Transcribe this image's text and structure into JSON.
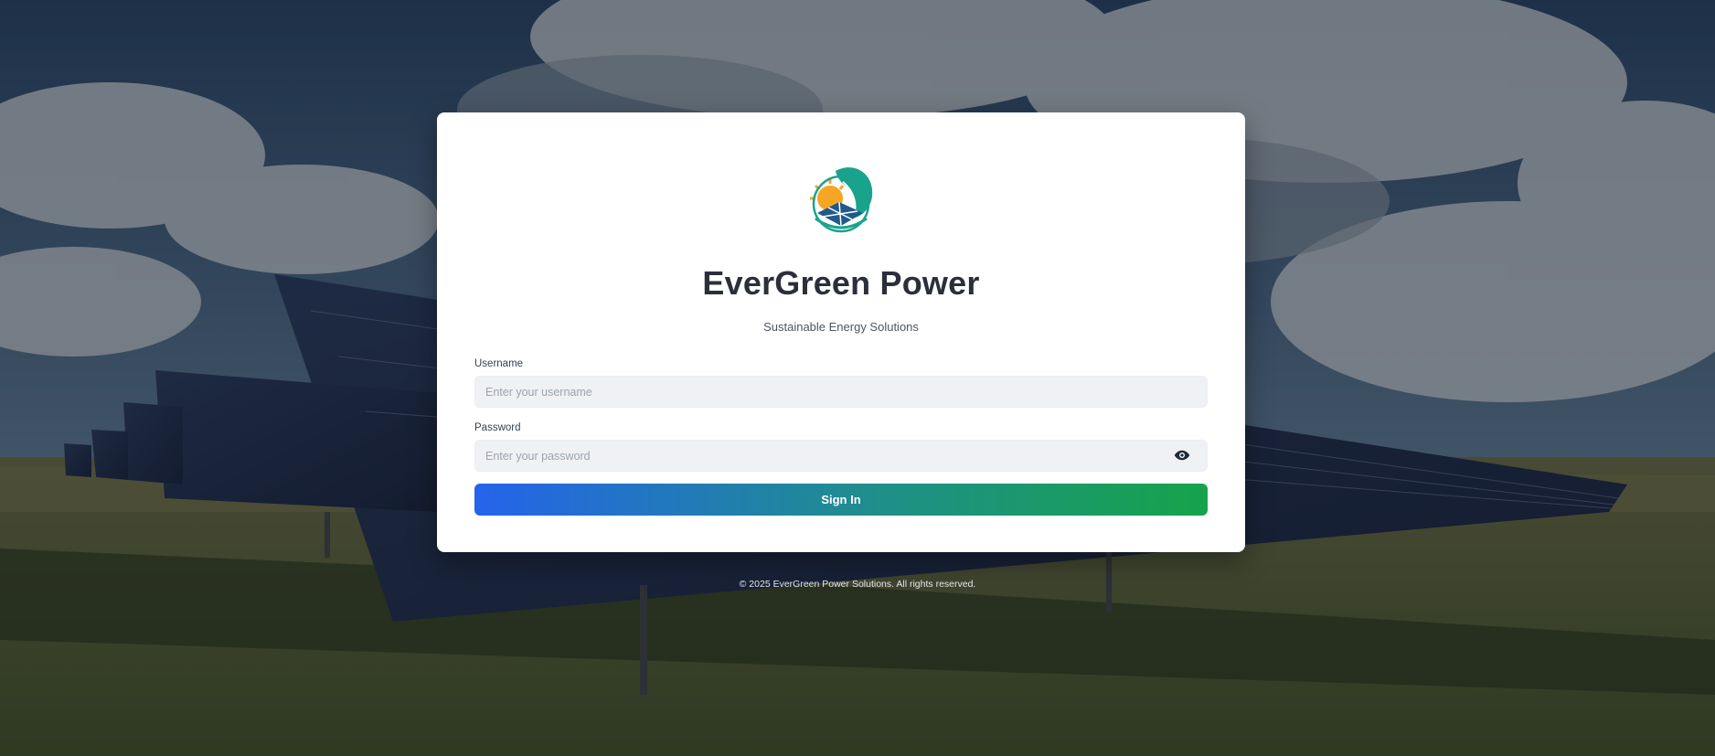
{
  "brand": {
    "name": "EverGreen Power",
    "tagline": "Sustainable Energy Solutions",
    "logo_icon": "evergreen-leaf-sun-solar-logo",
    "colors": {
      "primary_blue": "#2563eb",
      "primary_green": "#16a34a",
      "logo_teal": "#1aa38c",
      "logo_orange": "#f5a623"
    }
  },
  "login_form": {
    "username": {
      "label": "Username",
      "placeholder": "Enter your username",
      "value": ""
    },
    "password": {
      "label": "Password",
      "placeholder": "Enter your password",
      "value": "",
      "toggle_icon": "eye-icon"
    },
    "submit_label": "Sign In"
  },
  "footer": {
    "copyright": "© 2025 EverGreen Power Solutions. All rights reserved."
  }
}
